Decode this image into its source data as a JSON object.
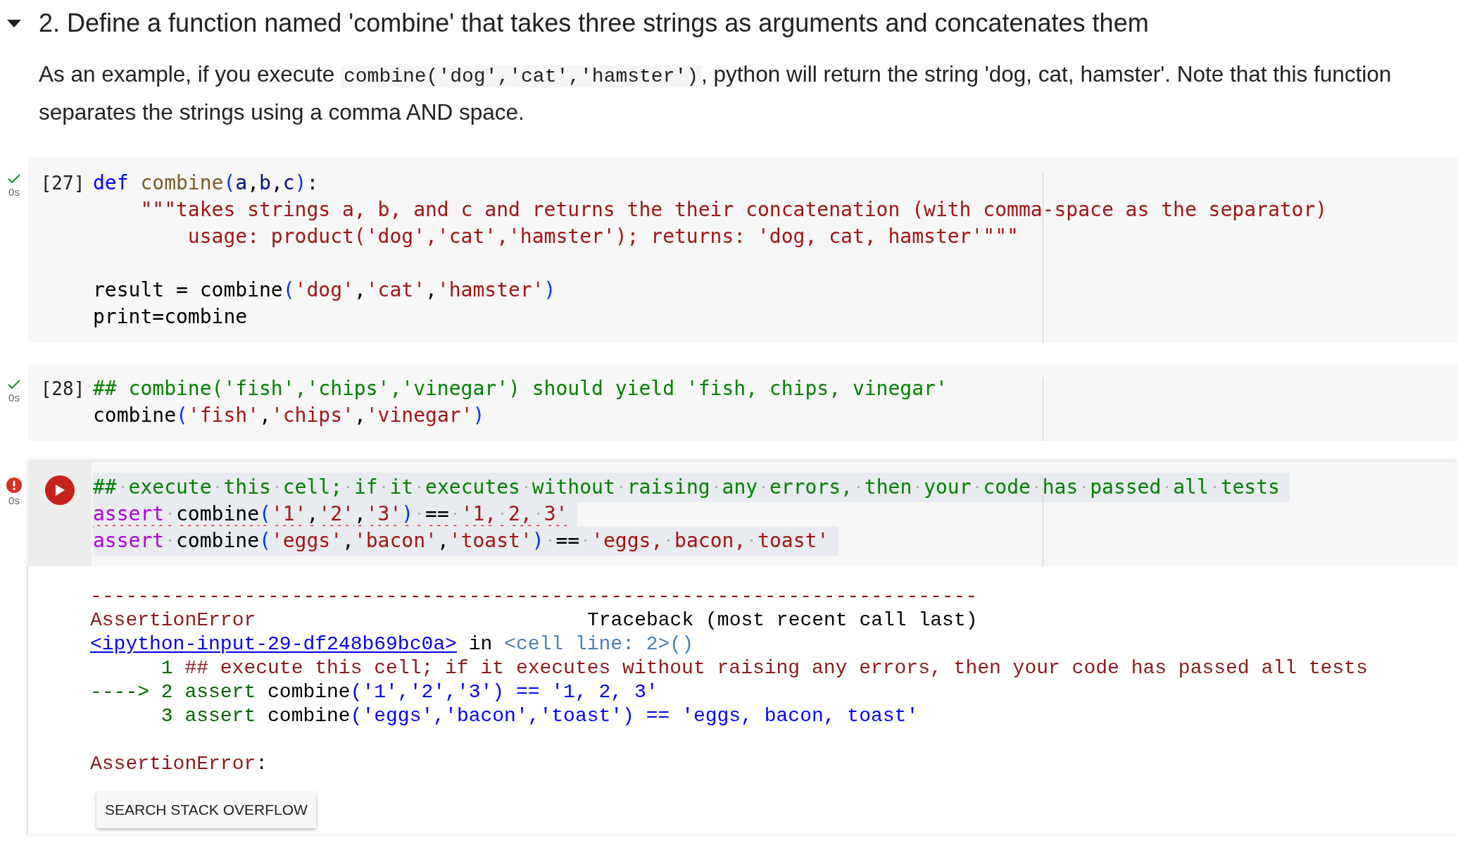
{
  "section": {
    "expanded": true,
    "title": "2. Define a function named 'combine' that takes three strings as arguments and concatenates them"
  },
  "description": [
    {
      "kind": "text",
      "text": "As an example, if you execute "
    },
    {
      "kind": "code",
      "text": "combine('dog','cat','hamster')"
    },
    {
      "kind": "text",
      "text": ", python will return the string 'dog, cat, hamster'. Note that this function separates the strings using a comma AND space."
    }
  ],
  "cells": [
    {
      "failed": false,
      "time": "0s",
      "count": "[27]",
      "lines": [
        {
          "kind": "code",
          "tokens": [
            {
              "kind": "keyword",
              "text": "def "
            },
            {
              "kind": "function",
              "text": "combine"
            },
            {
              "kind": "paren",
              "text": "("
            },
            {
              "kind": "param",
              "text": "a"
            },
            {
              "kind": "plain",
              "text": ","
            },
            {
              "kind": "param",
              "text": "b"
            },
            {
              "kind": "plain",
              "text": ","
            },
            {
              "kind": "param",
              "text": "c"
            },
            {
              "kind": "paren",
              "text": ")"
            },
            {
              "kind": "plain",
              "text": ":"
            }
          ]
        },
        {
          "kind": "code",
          "tokens": [
            {
              "kind": "string",
              "text": "    \"\"\"takes strings a, b, and c and returns the their concatenation (with comma-space as the separator)"
            }
          ]
        },
        {
          "kind": "code",
          "tokens": [
            {
              "kind": "string",
              "text": "        usage: product('dog','cat','hamster'); returns: 'dog, cat, hamster'\"\"\""
            }
          ]
        },
        {
          "kind": "blank"
        },
        {
          "kind": "code",
          "tokens": [
            {
              "kind": "plain",
              "text": "result = combine"
            },
            {
              "kind": "paren",
              "text": "("
            },
            {
              "kind": "string",
              "text": "'dog'"
            },
            {
              "kind": "plain",
              "text": ","
            },
            {
              "kind": "string",
              "text": "'cat'"
            },
            {
              "kind": "plain",
              "text": ","
            },
            {
              "kind": "string",
              "text": "'hamster'"
            },
            {
              "kind": "paren",
              "text": ")"
            }
          ]
        },
        {
          "kind": "code",
          "tokens": [
            {
              "kind": "plain",
              "text": "print=combine"
            }
          ]
        }
      ]
    },
    {
      "failed": false,
      "time": "0s",
      "count": "[28]",
      "lines": [
        {
          "kind": "code",
          "tokens": [
            {
              "kind": "comment",
              "text": "## combine('fish','chips','vinegar') should yield 'fish, chips, vinegar'"
            }
          ]
        },
        {
          "kind": "code",
          "tokens": [
            {
              "kind": "plain",
              "text": "combine"
            },
            {
              "kind": "paren",
              "text": "("
            },
            {
              "kind": "string",
              "text": "'fish'"
            },
            {
              "kind": "plain",
              "text": ","
            },
            {
              "kind": "string",
              "text": "'chips'"
            },
            {
              "kind": "plain",
              "text": ","
            },
            {
              "kind": "string",
              "text": "'vinegar'"
            },
            {
              "kind": "paren",
              "text": ")"
            }
          ]
        }
      ]
    },
    {
      "failed": true,
      "time": "0s",
      "focused": true,
      "show_whitespace": true,
      "lines": [
        {
          "kind": "code",
          "highlighted": true,
          "squiggle": false,
          "tokens": [
            {
              "kind": "comment",
              "text": "## execute this cell; if it executes without raising any errors, then your code has passed all tests"
            }
          ]
        },
        {
          "kind": "code",
          "highlighted": true,
          "squiggle": true,
          "tokens": [
            {
              "kind": "assert",
              "text": "assert"
            },
            {
              "kind": "plain",
              "text": " combine"
            },
            {
              "kind": "paren",
              "text": "("
            },
            {
              "kind": "string",
              "text": "'1'"
            },
            {
              "kind": "plain",
              "text": ","
            },
            {
              "kind": "string",
              "text": "'2'"
            },
            {
              "kind": "plain",
              "text": ","
            },
            {
              "kind": "string",
              "text": "'3'"
            },
            {
              "kind": "paren",
              "text": ")"
            },
            {
              "kind": "plain",
              "text": " == "
            },
            {
              "kind": "string",
              "text": "'1, 2, 3'"
            }
          ]
        },
        {
          "kind": "code",
          "highlighted": true,
          "squiggle": false,
          "tokens": [
            {
              "kind": "assert",
              "text": "assert"
            },
            {
              "kind": "plain",
              "text": " combine"
            },
            {
              "kind": "paren",
              "text": "("
            },
            {
              "kind": "string",
              "text": "'eggs'"
            },
            {
              "kind": "plain",
              "text": ","
            },
            {
              "kind": "string",
              "text": "'bacon'"
            },
            {
              "kind": "plain",
              "text": ","
            },
            {
              "kind": "string",
              "text": "'toast'"
            },
            {
              "kind": "paren",
              "text": ")"
            },
            {
              "kind": "plain",
              "text": " == "
            },
            {
              "kind": "string",
              "text": "'eggs, bacon, toast'"
            }
          ]
        }
      ],
      "output": {
        "lines": [
          {
            "kind": "rule",
            "text": "---------------------------------------------------------------------------"
          },
          {
            "kind": "header",
            "error_name": "AssertionError",
            "title": "Traceback (most recent call last)"
          },
          {
            "kind": "location",
            "link": "<ipython-input-29-df248b69bc0a>",
            "middle": " in ",
            "place": "<cell line: 2>()"
          },
          {
            "kind": "source",
            "number": "1",
            "tokens": [
              {
                "kind": "comment",
                "text": "## execute this cell; if it executes without raising any errors, then your code has passed all tests"
              }
            ]
          },
          {
            "kind": "source",
            "marker": "---->",
            "number": "2",
            "tokens": [
              {
                "kind": "keyword",
                "text": "assert"
              },
              {
                "kind": "plain",
                "text": " combine"
              },
              {
                "kind": "string",
                "text": "('1','2','3') == '1, 2, 3'"
              }
            ]
          },
          {
            "kind": "source",
            "number": "3",
            "tokens": [
              {
                "kind": "keyword",
                "text": "assert"
              },
              {
                "kind": "plain",
                "text": " combine"
              },
              {
                "kind": "string",
                "text": "('eggs','bacon','toast') == 'eggs, bacon, toast'"
              }
            ]
          },
          {
            "kind": "blank"
          },
          {
            "kind": "error",
            "error_name": "AssertionError",
            "rest": ":"
          }
        ],
        "button": "SEARCH STACK OVERFLOW"
      }
    }
  ]
}
